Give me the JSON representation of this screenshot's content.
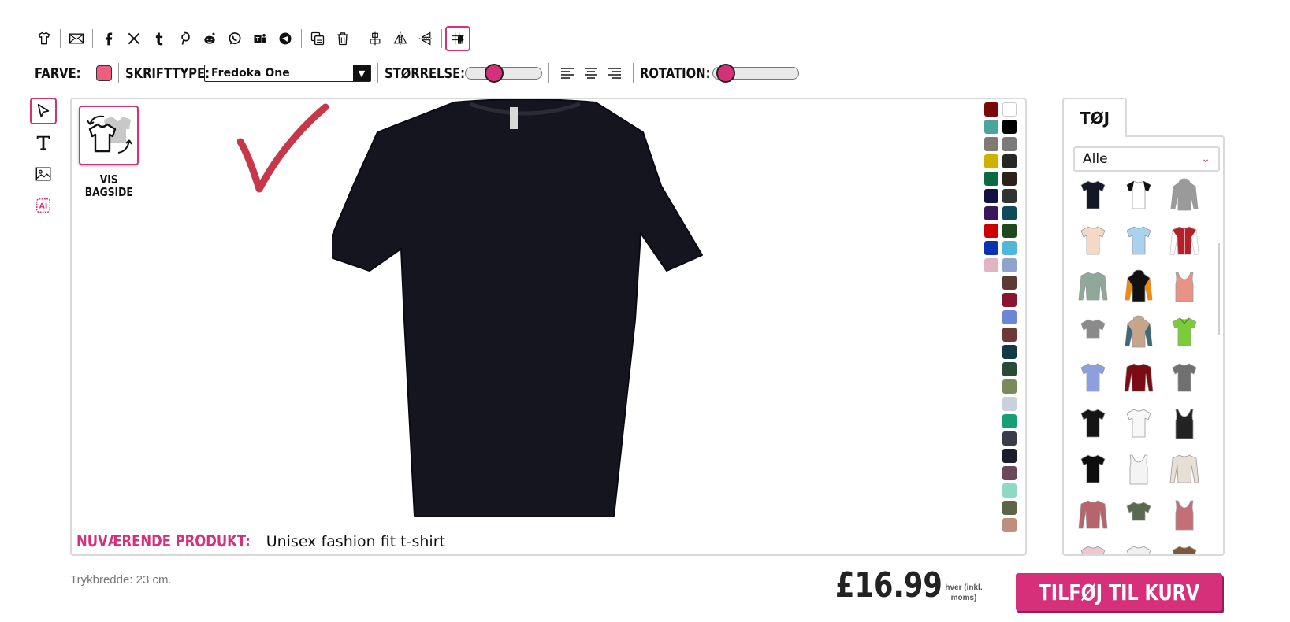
{
  "toolbar1": {
    "buttons": [
      {
        "name": "tshirt-icon"
      },
      {
        "name": "mail-icon"
      },
      {
        "name": "facebook-icon"
      },
      {
        "name": "x-icon"
      },
      {
        "name": "tumblr-icon"
      },
      {
        "name": "pinterest-icon"
      },
      {
        "name": "reddit-icon"
      },
      {
        "name": "whatsapp-icon"
      },
      {
        "name": "teams-icon"
      },
      {
        "name": "telegram-icon"
      },
      {
        "name": "duplicate-icon"
      },
      {
        "name": "trash-icon"
      },
      {
        "name": "align-center-icon"
      },
      {
        "name": "flip-horizontal-icon"
      },
      {
        "name": "flip-vertical-icon"
      },
      {
        "name": "grid-snap-icon"
      }
    ]
  },
  "toolbar2": {
    "color_label": "FARVE:",
    "color_value": "#ee5f7d",
    "font_label": "SKRIFTTYPE:",
    "font_value": "Fredoka One",
    "size_label": "STØRRELSE:",
    "size_level": 0.33,
    "rotation_label": "ROTATION:",
    "rotation_level": 0.05
  },
  "backside": {
    "label_line1": "VIS",
    "label_line2": "BAGSIDE"
  },
  "product": {
    "label": "NUVÆRENDE PRODUKT:",
    "name": "Unisex fashion fit t-shirt",
    "garment_color": "#151520"
  },
  "colors": [
    "#7a0a0a",
    "#ffffff",
    "#4aa59a",
    "#000000",
    "#807a72",
    "#7a7a7a",
    "#d1b000",
    "#262626",
    "#0b6a3f",
    "#2a2219",
    "#111144",
    "#333333",
    "#3a1560",
    "#0d4a5b",
    "#cc0000",
    "#1c4a1c",
    "#0a33b0",
    "#4fb7da",
    "#e0b4c0",
    "#8ea4cc",
    "",
    "#5c3a33",
    "",
    "#8a1530",
    "",
    "#6a86d4",
    "",
    "#6e3838",
    "",
    "#123a44",
    "",
    "#2a4a38",
    "",
    "#7a8a5a",
    "",
    "#c9d0de",
    "",
    "#169e74",
    "",
    "#3a3c4a",
    "",
    "#1a1d2c",
    "",
    "#6a4a5a",
    "",
    "#8ed8c4",
    "",
    "#5e6448",
    "",
    "#c08e7c"
  ],
  "clothes_panel": {
    "tab_label": "TØJ",
    "category": "Alle",
    "items": [
      {
        "kind": "tee",
        "color": "#141826"
      },
      {
        "kind": "raglan",
        "color": "#ffffff",
        "accent": "#111111"
      },
      {
        "kind": "hoodie",
        "color": "#9a9a9a"
      },
      {
        "kind": "tee",
        "color": "#f3d9c6"
      },
      {
        "kind": "tee",
        "color": "#a8d2ee"
      },
      {
        "kind": "jacket",
        "color": "#b3202a",
        "accent": "#ffffff"
      },
      {
        "kind": "longsleeve",
        "color": "#8fa898"
      },
      {
        "kind": "hoodie",
        "color": "#111111",
        "accent": "#f08a10"
      },
      {
        "kind": "tank",
        "color": "#e89386"
      },
      {
        "kind": "crop",
        "color": "#8a8a8a"
      },
      {
        "kind": "hoodie",
        "color": "#c7a58a",
        "accent": "#3c6a7a"
      },
      {
        "kind": "polo",
        "color": "#7ccc3a"
      },
      {
        "kind": "tee",
        "color": "#8d9fdc"
      },
      {
        "kind": "longsleeve",
        "color": "#7a0c14"
      },
      {
        "kind": "tee",
        "color": "#707070"
      },
      {
        "kind": "tee",
        "color": "#151515"
      },
      {
        "kind": "tee",
        "color": "#f8f8f8"
      },
      {
        "kind": "tank",
        "color": "#222222"
      },
      {
        "kind": "tee",
        "color": "#0e0e0e"
      },
      {
        "kind": "tank",
        "color": "#f4f4f4"
      },
      {
        "kind": "longsleeve",
        "color": "#e8dfd4"
      },
      {
        "kind": "longsleeve",
        "color": "#b7656c"
      },
      {
        "kind": "crop",
        "color": "#5a6a4e"
      },
      {
        "kind": "tank",
        "color": "#c46f78"
      },
      {
        "kind": "tee",
        "color": "#f2c6d0"
      },
      {
        "kind": "tee",
        "color": "#f0f0f0"
      },
      {
        "kind": "tee",
        "color": "#7a5a3a"
      }
    ]
  },
  "footer": {
    "print_width": "Trykbredde: 23 cm.",
    "price": "£16.99",
    "price_note": "hver (inkl. moms)",
    "add_to_cart": "TILFØJ TIL KURV"
  },
  "accent": "#d6307b"
}
